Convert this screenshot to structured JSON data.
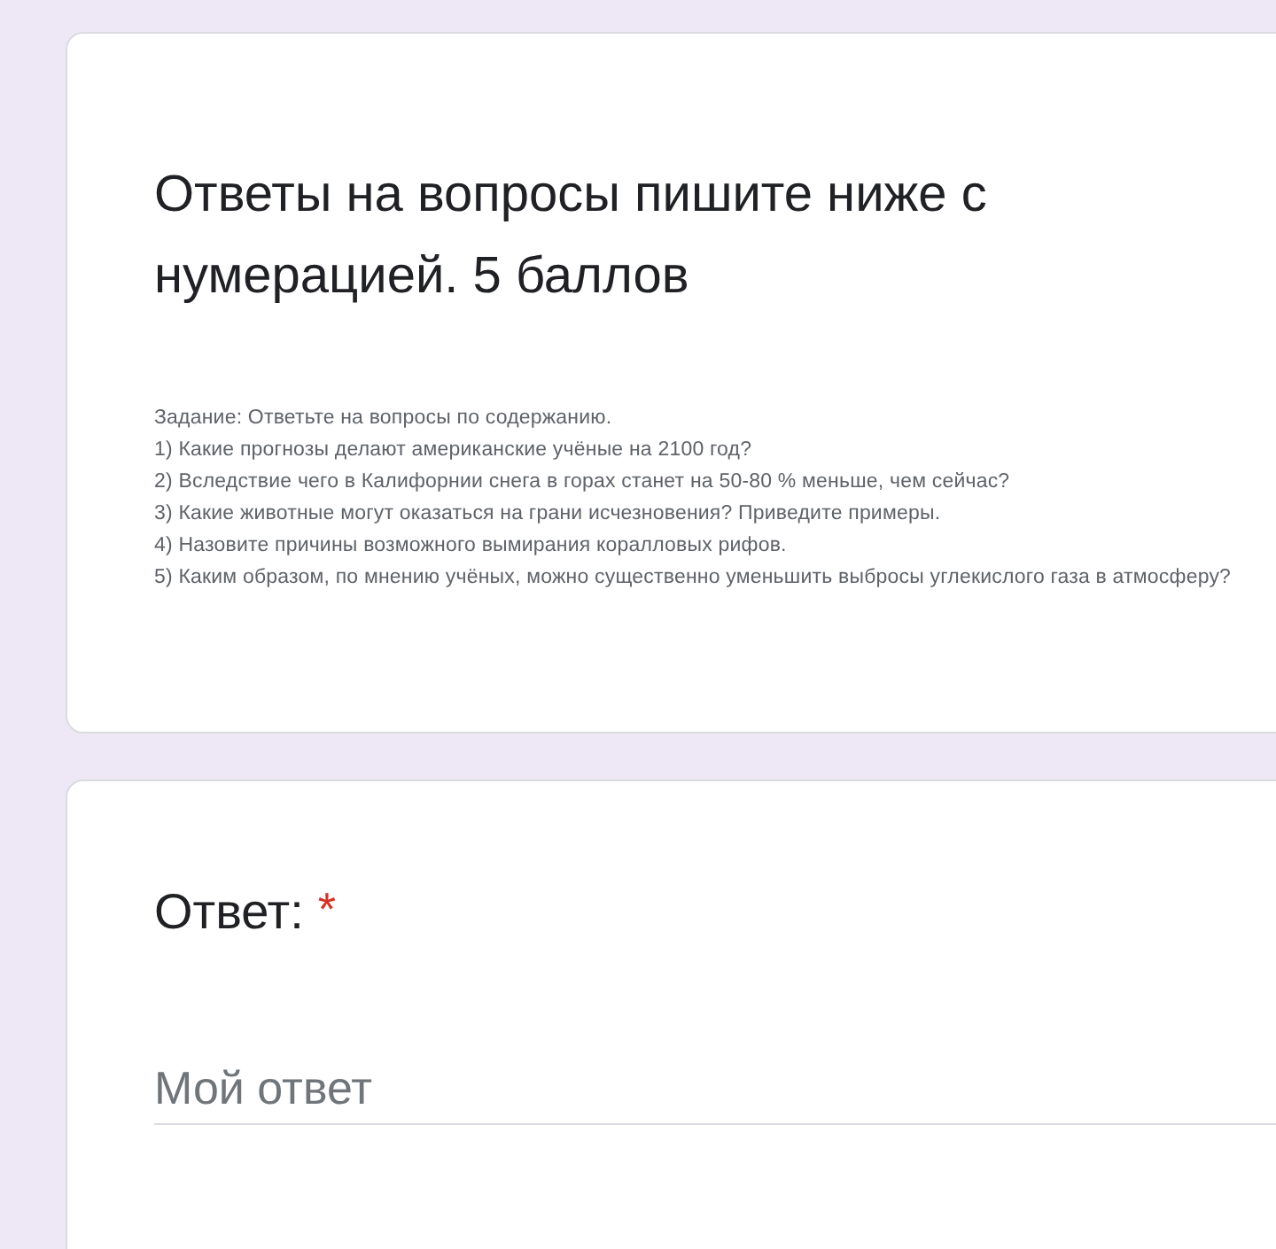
{
  "header_card": {
    "title": "Ответы на вопросы пишите ниже с нумерацией. 5 баллов",
    "task_lines": [
      "Задание: Ответьте на вопросы по содержанию.",
      "1) Какие прогнозы делают американские учёные на 2100 год?",
      "2) Вследствие чего в Калифорнии снега в горах станет на 50-80 % меньше, чем сейчас?",
      "3) Какие животные могут оказаться на грани исчезновения? Приведите примеры.",
      "4) Назовите причины возможного вымирания коралловых рифов.",
      "5) Каким образом, по мнению учёных, можно существенно уменьшить выбросы углекислого газа в атмосферу?"
    ]
  },
  "question_card": {
    "label": "Ответ:",
    "required": true,
    "required_mark": "*",
    "answer": {
      "placeholder": "Мой ответ"
    }
  }
}
